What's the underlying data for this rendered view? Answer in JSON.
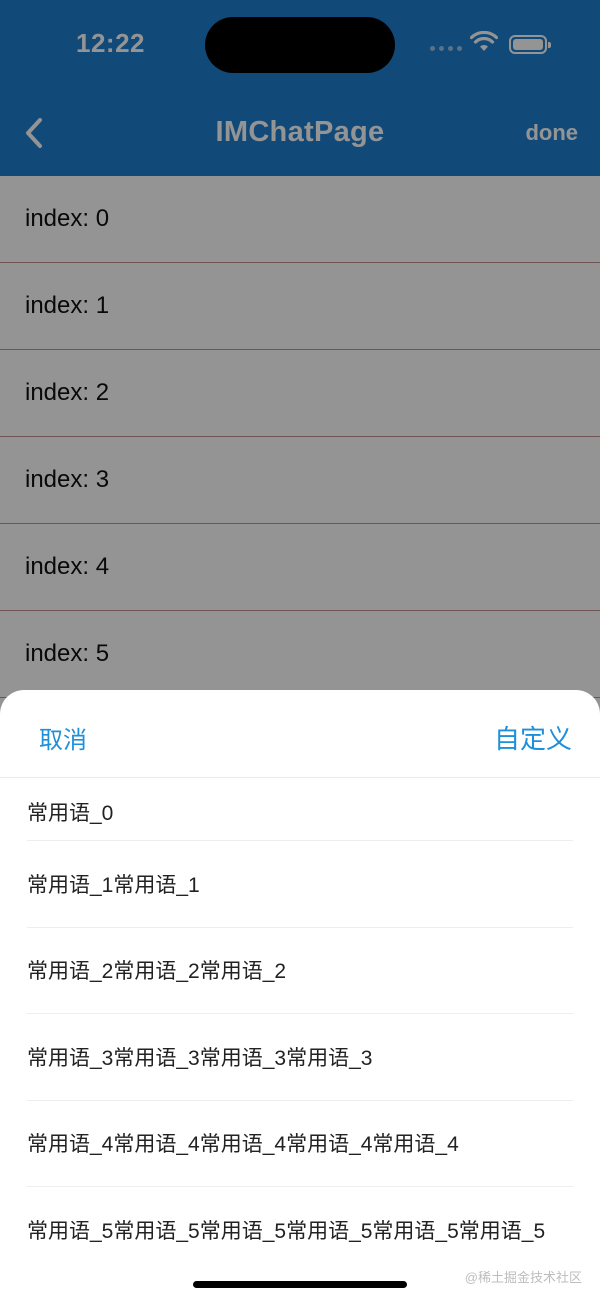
{
  "status_bar": {
    "time": "12:22"
  },
  "nav": {
    "title": "IMChatPage",
    "done_label": "done"
  },
  "index_list": [
    "index: 0",
    "index: 1",
    "index: 2",
    "index: 3",
    "index: 4",
    "index: 5"
  ],
  "sheet": {
    "cancel_label": "取消",
    "custom_label": "自定义",
    "phrases": [
      "常用语_0",
      "常用语_1常用语_1",
      "常用语_2常用语_2常用语_2",
      "常用语_3常用语_3常用语_3常用语_3",
      "常用语_4常用语_4常用语_4常用语_4常用语_4",
      "常用语_5常用语_5常用语_5常用语_5常用语_5常用语_5"
    ]
  },
  "watermark": "@稀土掘金技术社区",
  "colors": {
    "header_bg": "#1e7fd0",
    "accent": "#1e8fdb",
    "row_divider": "#c48f8f"
  },
  "icons": {
    "back": "chevron-left-icon",
    "wifi": "wifi-icon",
    "battery": "battery-icon",
    "signal": "signal-icon"
  }
}
